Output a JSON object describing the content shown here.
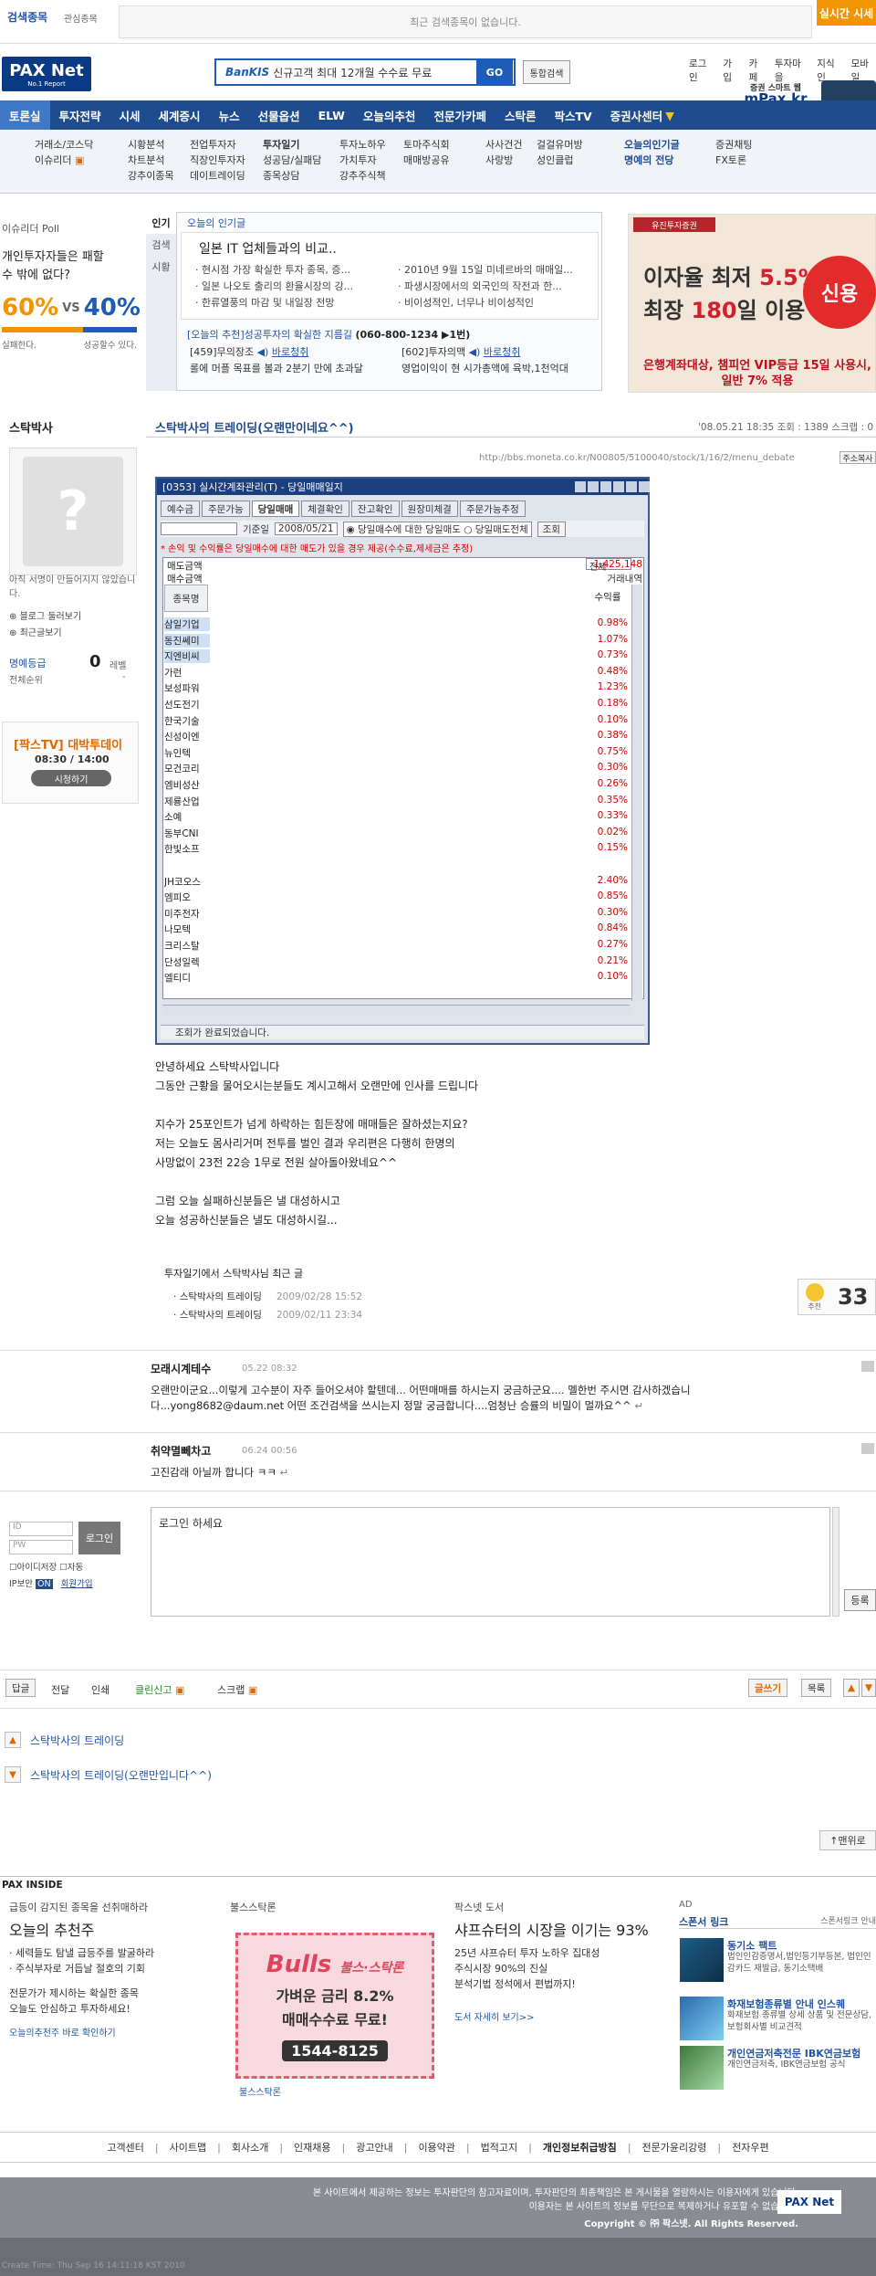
{
  "topbar": {
    "search_label": "검색종목",
    "interest_label": "관심종목",
    "recent_msg": "최근 검색종목이 없습니다.",
    "realtime_btn": "실시간 시세"
  },
  "header": {
    "logo": "PAX Net",
    "logo_sub": "No.1 Report",
    "banner_brand": "BanKIS",
    "banner_text": "신규고객 최대 12개월 수수료 무료",
    "go": "GO",
    "total_search": "통합검색",
    "util_links": [
      "로그인",
      "가입",
      "카페",
      "투자마을",
      "지식인",
      "모바일"
    ],
    "mpax_line1": "증권 스마트 웹",
    "mpax_line2": "mPax.kr"
  },
  "nav": {
    "items": [
      "토론실",
      "투자전략",
      "시세",
      "세계증시",
      "뉴스",
      "선물옵션",
      "ELW",
      "오늘의추천",
      "전문가카페",
      "스탁론",
      "팍스TV",
      "증권사센터"
    ]
  },
  "subnav": {
    "cols": [
      [
        "거래소/코스닥",
        "이슈리더"
      ],
      [
        "시황분석",
        "차트분석",
        "강추이종목"
      ],
      [
        "전업투자자",
        "직장인투자자",
        "데이트레이딩"
      ],
      [
        "투자일기",
        "성공담/실패담",
        "종목상담"
      ],
      [
        "투자노하우",
        "가치투자",
        "강추주식책"
      ],
      [
        "토마주식회",
        "매매방공유"
      ],
      [
        "사사건건",
        "사랑방"
      ],
      [
        "걸걸유머방",
        "성인클럽"
      ],
      [
        "오늘의인기글",
        "명예의 전당"
      ],
      [
        "증권채팅",
        "FX토론"
      ]
    ]
  },
  "poll": {
    "title": "이슈리더 Poll",
    "question_l1": "개인투자자들은 패할",
    "question_l2": "수 밖에 없다?",
    "left_pct": "60%",
    "vs": "VS",
    "right_pct": "40%",
    "left_fraction": 0.6,
    "left_label": "실패한다.",
    "right_label": "성공할수 있다."
  },
  "popular": {
    "tabs": [
      "인기",
      "검색",
      "시황"
    ],
    "head": "오늘의 인기글",
    "title": "일본 IT 업체들과의 비교..",
    "items": [
      "현시점 가장 확실한 투자 종목, 증...",
      "2010년 9월 15일 미네르바의 매매일...",
      "일본 나오토 출리의 환율시장의 강...",
      "파생시장에서의 외국인의 작전과 한...",
      "한류열풍의 마감 및 내일장 전망",
      "비이성적인, 너무나 비이성적인"
    ],
    "rec_prefix": "[오늘의 추천]성공투자의 확실한 지름길",
    "rec_phone": "(060-800-1234 ▶1번)",
    "rec1_title": "[459]무의장조",
    "rec1_link": "바로청취",
    "rec1_desc": "롤에 머플 목표를 볼과 2분기 만에 초과달",
    "rec2_title": "[602]투자의맥",
    "rec2_link": "바로청취",
    "rec2_desc": "영업이익이 현 시가총액에 육박,1천억대"
  },
  "ad_right": {
    "head": "유진투자증권",
    "line1_pre": "이자율 최저",
    "line1_val": "5.5%",
    "line2_pre": "최장",
    "line2_val": "180",
    "line2_post": "일 이용",
    "ball": "신용",
    "foot1": "은행계좌대상, 챔피언 VIP등급 15일 사용시,",
    "foot2": "일반 7% 적용"
  },
  "author": {
    "name": "스탁박사",
    "no_sig": "아직 서명이 만들어지지 않았습니다.",
    "blog_link": "블로그 둘러보기",
    "recent_link": "최근글보기",
    "honor_label": "명예등급",
    "honor_val": "0",
    "honor_unit": "레벨",
    "rank_label": "전체순위",
    "rank_val": "-"
  },
  "paxtv": {
    "title": "[팍스TV] 대박투데이",
    "time": "08:30 / 14:00",
    "btn": "시청하기"
  },
  "post": {
    "title": "스탁박사의 트레이딩(오랜만이네요^^)",
    "meta": "'08.05.21 18:35   조회 : 1389   스크랩 : 0",
    "url": "http://bbs.moneta.co.kr/N00805/5100040/stock/1/16/2/menu_debate",
    "url_btn": "주소복사"
  },
  "window": {
    "title": "[0353] 실시간계좌관리(T) - 당일매매일지",
    "tabs": [
      "예수금",
      "주문가능",
      "당일매매",
      "체결확인",
      "잔고확인",
      "원장미체결",
      "주문가능추정"
    ],
    "date_label": "기준일",
    "date": "2008/05/21",
    "radio1": "당일매수에 대한 당일매도",
    "radio2": "당일매도전체",
    "query_btn": "조회",
    "warn": "* 손익 및 수익률은 당일매수에 대한 매도가 있을 경우 제공(수수료,제세금은 추정)",
    "all_label": "전체",
    "sell_amount_label": "매도금액",
    "settle_label": "매수금액",
    "sell_amount_val": "1,425,148",
    "trade_label": "거래내역",
    "col_name": "종목명",
    "col_rate": "수익률",
    "rows": [
      {
        "name": "삼일기업",
        "rate": "0.98%"
      },
      {
        "name": "동진쎄미",
        "rate": "1.07%"
      },
      {
        "name": "지엔비씨",
        "rate": "0.73%"
      },
      {
        "name": "가런",
        "rate": "0.48%"
      },
      {
        "name": "보성파워",
        "rate": "1.23%"
      },
      {
        "name": "선도전기",
        "rate": "0.18%"
      },
      {
        "name": "한국기술",
        "rate": "0.10%"
      },
      {
        "name": "신성이엔",
        "rate": "0.38%"
      },
      {
        "name": "뉴인텍",
        "rate": "0.75%"
      },
      {
        "name": "모건코리",
        "rate": "0.30%"
      },
      {
        "name": "엠비성산",
        "rate": "0.26%"
      },
      {
        "name": "제룡산업",
        "rate": "0.35%"
      },
      {
        "name": "소예",
        "rate": "0.33%"
      },
      {
        "name": "동부CNI",
        "rate": "0.02%"
      },
      {
        "name": "한빛소프",
        "rate": "0.15%"
      },
      {
        "name": "",
        "rate": ""
      },
      {
        "name": "JH코오스",
        "rate": "2.40%"
      },
      {
        "name": "엠피오",
        "rate": "0.85%"
      },
      {
        "name": "미주전자",
        "rate": "0.30%"
      },
      {
        "name": "나모텍",
        "rate": "0.84%"
      },
      {
        "name": "크리스탈",
        "rate": "0.27%"
      },
      {
        "name": "단성일렉",
        "rate": "0.21%"
      },
      {
        "name": "엘티디",
        "rate": "0.10%"
      }
    ],
    "status": "조회가 완료되었습니다."
  },
  "body": {
    "lines": [
      "안녕하세요 스탁박사입니다",
      "그동안 근황을 물어오시는분들도 계시고해서 오랜만에 인사를 드립니다",
      "",
      "지수가 25포인트가 넘게 하락하는 힘든장에 매매들은 잘하셨는지요?",
      "저는 오늘도 몸사리거며 전투를 벌인 결과 우리편은 다행히 한명의",
      "사망없이 23전 22승 1무로 전원 살아돌아왔네요^^",
      "",
      "그럼 오늘 실패하신분들은 낼 대성하시고",
      "오늘 성공하신분들은 낼도 대성하시길..."
    ],
    "recent_title": "투자일기에서 스탁박사님 최근 글",
    "recent_posts": [
      {
        "title": "스탁박사의 트레이딩",
        "date": "2009/02/28 15:52"
      },
      {
        "title": "스탁박사의 트레이딩",
        "date": "2009/02/11 23:34"
      }
    ],
    "reco_label": "추천",
    "reco_count": "33"
  },
  "comments": [
    {
      "name": "모래시계테수",
      "date": "05.22 08:32",
      "text1": "오랜만이군요...이렇게 고수분이 자주 들어오셔야 할텐데... 어떤매매를 하시는지 궁금하군요.... 멜한번 주시면 감사하겠습니",
      "text2": "다...yong8682@daum.net 어떤 조건검색을 쓰시는지 정말 궁금합니다....엄청난 승률의 비밀이 멀까요^^"
    },
    {
      "name": "취약멸뻬차고",
      "date": "06.24 00:56",
      "text1": "고진감래 아닐까 합니다 ㅋㅋ",
      "text2": ""
    }
  ],
  "login": {
    "id_ph": "ID",
    "pw_ph": "PW",
    "btn": "로그인",
    "save_id": "아이디저장",
    "auto": "자동",
    "ip_label": "IP보안",
    "ip_state": "ON",
    "join": "회원가입"
  },
  "comment_form": {
    "placeholder": "로그인 하세요",
    "submit": "등록"
  },
  "actions": {
    "reply": "답글",
    "forward": "전달",
    "print": "인쇄",
    "clean": "클린신고",
    "scrap": "스크랩",
    "write": "글쓰기",
    "list": "목록"
  },
  "prevnext": [
    {
      "title": "스탁박사의 트레이딩"
    },
    {
      "title": "스탁박사의 트레이딩(오랜만입니다^^)"
    }
  ],
  "top_btn": "맨위로",
  "pax_inside": {
    "title": "PAX INSIDE",
    "col1_head": "급등이 감지된 종목을 선취매하라",
    "col1_big": "오늘의 추천주",
    "col1_items": [
      "세력들도 탐낼 급등주를 발굴하라",
      "주식부자로 거듭날 절호의 기회"
    ],
    "col1_p1": "전문가가 제시하는 확실한 종목",
    "col1_p2": "오늘도 안심하고 투자하세요!",
    "col1_link": "오늘의추천주 바로 확인하기",
    "col2_head": "불스스탁론",
    "bulls_t1": "Bulls",
    "bulls_t1b": "불스·스탁론",
    "bulls_t2": "가벼운 금리 8.2%",
    "bulls_t3": "매매수수료 무료!",
    "bulls_phone": "1544-8125",
    "col2_link": "불스스탁론",
    "col3_head": "팍스넷 도서",
    "col3_big": "샤프슈터의 시장을 이기는 93%",
    "col3_items": [
      "25년 샤프슈터 투자 노하우 집대성",
      "주식시장 90%의 진실",
      "분석기법 정석에서 편법까지!"
    ],
    "col3_link": "도서 자세히 보기>>",
    "ad_label": "AD",
    "sponsor_head": "스폰서 링크",
    "sponsor_more": "스폰서링크 안내",
    "sponsors": [
      {
        "title": "동기소 팩트",
        "desc": "법인인감증명서,법인등기부등본, 법인인감카드 재발급, 동기소택배"
      },
      {
        "title": "화재보험종류별 안내 인스퀘",
        "desc": "화재보험 종류별 상세 상품 및 전문상담, 보험회사별 비교견적"
      },
      {
        "title": "개인연금저축전문 IBK연금보험",
        "desc": "개인연금저축, IBK연금보험 공식"
      }
    ]
  },
  "footer": {
    "links": [
      "고객센터",
      "사이트맵",
      "회사소개",
      "인재채용",
      "광고안내",
      "이용약관",
      "법적고지",
      "개인정보취급방침",
      "전문가윤리강령",
      "전자우편"
    ],
    "text1": "본 사이트에서 제공하는 정보는 투자판단의 참고자료이며, 투자판단의 최종책임은 본 게시물을 열람하시는 이용자에게 있습니다.",
    "text2": "이용자는 본 사이트의 정보를 무단으로 복제하거나 유포할 수 없습니다.",
    "copyright": "Copyright © ㈜ 팍스넷. All Rights Reserved.",
    "logo": "PAX Net",
    "time": "Create Time: Thu Sep 16 14:11:18 KST 2010"
  }
}
